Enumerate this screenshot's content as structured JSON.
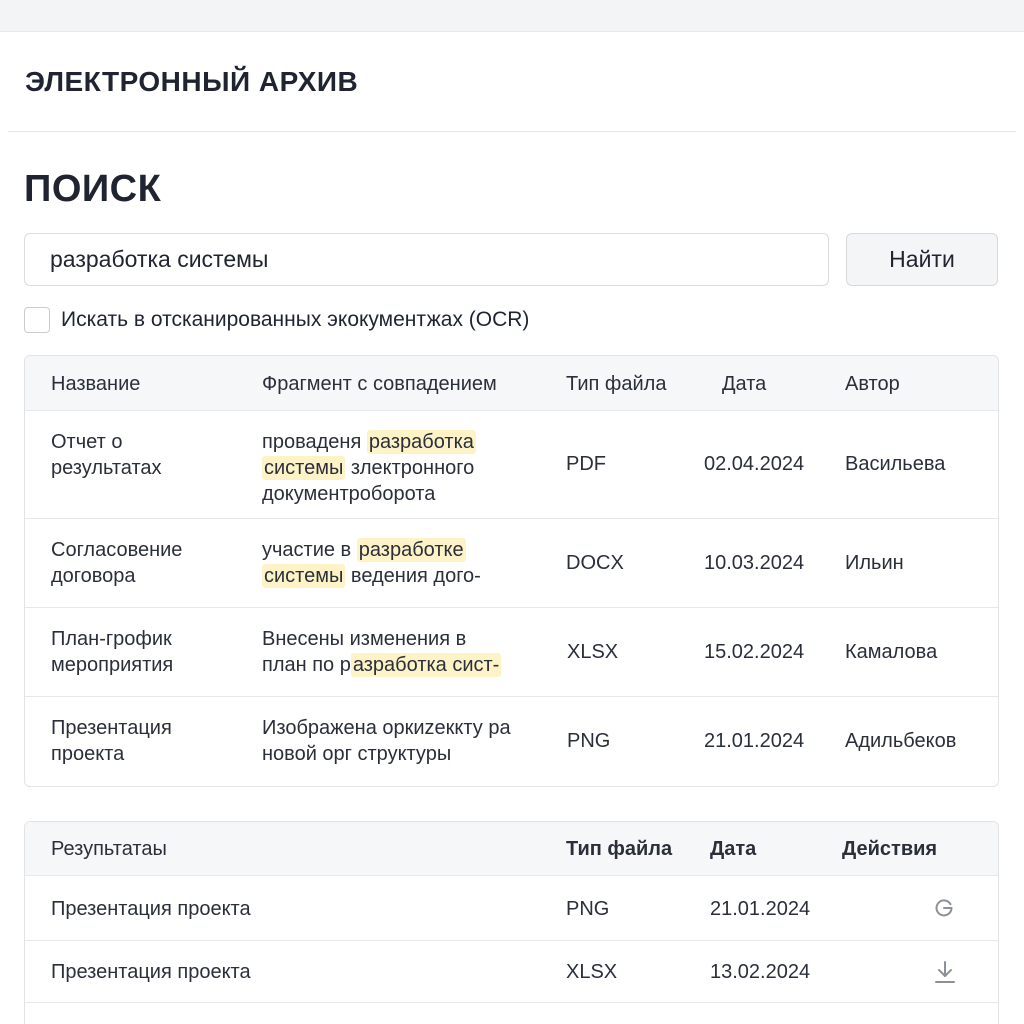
{
  "app": {
    "title": "ЭЛЕКТРОННЫЙ АРХИВ"
  },
  "page": {
    "title": "ПОИСК"
  },
  "search": {
    "value": "разработка системы",
    "placeholder": "",
    "button_label": "Найти"
  },
  "ocr": {
    "label": "Искать в отсканированных экокументжах (OCR)",
    "checked": false
  },
  "results_table": {
    "headers": [
      "Название",
      "Фрагмент с совпадением",
      "Тип файла",
      "Дата",
      "Автор"
    ],
    "rows": [
      {
        "name": [
          "Отчет о",
          "результатах"
        ],
        "fragment_pre": "проваденя ",
        "fragment_hl1": "разработка",
        "fragment_line2_hl": "системы",
        "fragment_line2_post": " злектронного",
        "fragment_line3": "документроборота",
        "type": "PDF",
        "date": "02.04.2024",
        "author": "Васильева"
      },
      {
        "name": [
          "Согласовение",
          "договора"
        ],
        "fragment_pre": "участие в ",
        "fragment_hl1": "разработке",
        "fragment_line2_hl": "системы",
        "fragment_line2_post": " ведения дого-",
        "type": "DOCX",
        "date": "10.03.2024",
        "author": "Ильин"
      },
      {
        "name": [
          "План-грофик",
          "мероприятия"
        ],
        "fragment_line1": "Внесены изменения в",
        "fragment_line2_pre": "план по р",
        "fragment_line2_hl": "азработка сист-",
        "type": "XLSX",
        "date": "15.02.2024",
        "author": "Камалова"
      },
      {
        "name": [
          "Презентация",
          "проекта"
        ],
        "fragment_line1": "Изображена оркиzеккту ра",
        "fragment_line2": "новой орг структуры",
        "type": "PNG",
        "date": "21.01.2024",
        "author": "Адильбеков"
      }
    ]
  },
  "files_table": {
    "headers": [
      "Резупьтатаы",
      "Тип файла",
      "Дата",
      "Действия"
    ],
    "rows": [
      {
        "name": "Презентация проекта",
        "type": "PNG",
        "date": "21.01.2024",
        "action_icon": "refresh-icon"
      },
      {
        "name": "Презентация проекта",
        "type": "XLSX",
        "date": "13.02.2024",
        "action_icon": "download-icon"
      }
    ]
  },
  "colors": {
    "highlight": "#fdf3c7",
    "header_bg": "#f6f7f9",
    "border": "#e1e3e7",
    "text": "#1f2430"
  }
}
